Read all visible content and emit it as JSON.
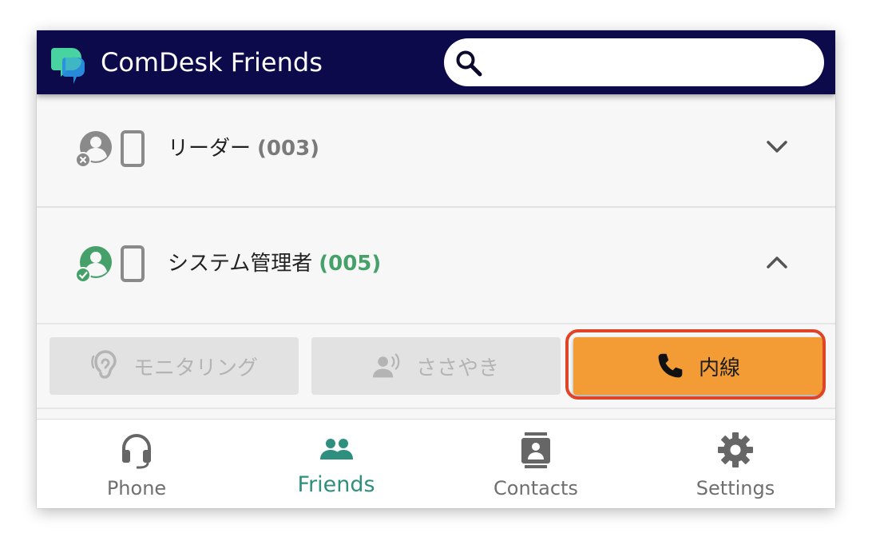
{
  "app": {
    "title": "ComDesk Friends",
    "search_placeholder": ""
  },
  "groups": [
    {
      "name": "リーダー",
      "count": "(003)",
      "status": "offline",
      "expanded": false
    },
    {
      "name": "システム管理者",
      "count": "(005)",
      "status": "online",
      "expanded": true
    }
  ],
  "actions": {
    "monitoring": "モニタリング",
    "whisper": "ささやき",
    "extension": "内線"
  },
  "nav": {
    "phone": "Phone",
    "friends": "Friends",
    "contacts": "Contacts",
    "settings": "Settings",
    "active": "friends"
  },
  "colors": {
    "appbar": "#0c0a4a",
    "accent_green": "#45a06a",
    "nav_active": "#2f8f7e",
    "extension_button": "#f39c36",
    "highlight": "#e04428"
  },
  "icons": {
    "logo": "comdesk-logo",
    "search": "search-icon",
    "offline_status": "user-offline-icon",
    "online_status": "user-online-icon",
    "device": "mobile-phone-icon",
    "expand": "chevron-down-icon",
    "collapse": "chevron-up-icon",
    "monitoring": "ear-icon",
    "whisper": "speaking-person-icon",
    "extension": "phone-handset-icon",
    "phone": "headset-icon",
    "friends": "people-icon",
    "contacts": "contact-card-icon",
    "settings": "gear-icon"
  }
}
